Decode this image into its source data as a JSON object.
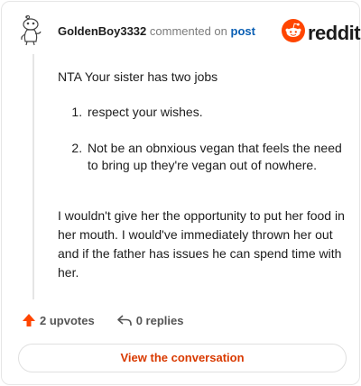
{
  "comment": {
    "username": "GoldenBoy3332",
    "action_text": "commented on",
    "post_link": "post",
    "body_intro": "NTA Your sister has two jobs",
    "list_items": [
      "respect your wishes.",
      "Not be an obnxious vegan that feels the need to bring up they're vegan out of nowhere."
    ],
    "body_paragraph": "I wouldn't give her the opportunity to put her food in her mouth. I would've immediately thrown her out and if the father has issues he can spend time with her."
  },
  "brand": {
    "wordmark": "reddit",
    "color": "#ff4500"
  },
  "actions": {
    "upvotes_label": "2 upvotes",
    "replies_label": "0 replies"
  },
  "cta": {
    "label": "View the conversation",
    "color": "#d93a00"
  },
  "icons": {
    "avatar": "snoo-avatar-icon",
    "logo": "reddit-logo-icon",
    "upvote": "upvote-arrow-icon",
    "reply": "reply-arrow-icon"
  }
}
